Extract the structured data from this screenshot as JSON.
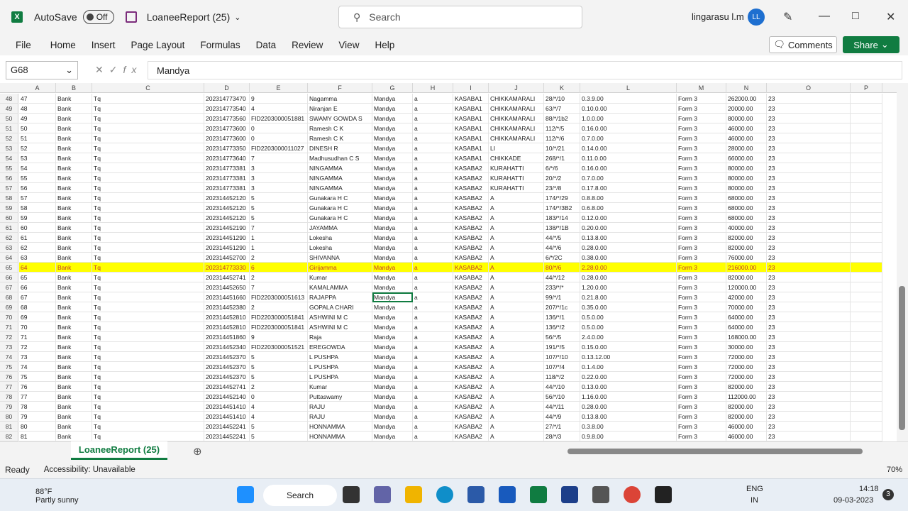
{
  "title": {
    "autosave_label": "AutoSave",
    "toggle_state": "Off",
    "doc_name": "LoaneeReport (25)",
    "search_placeholder": "Search",
    "user_name": "lingarasu l.m",
    "avatar_initials": "LL"
  },
  "menu": {
    "items": [
      "File",
      "Home",
      "Insert",
      "Page Layout",
      "Formulas",
      "Data",
      "Review",
      "View",
      "Help"
    ],
    "comments_label": "Comments",
    "share_label": "Share"
  },
  "formula": {
    "name_box": "G68",
    "fx": "fx",
    "value": "Mandya"
  },
  "columns": [
    "A",
    "B",
    "C",
    "D",
    "E",
    "F",
    "G",
    "H",
    "I",
    "J",
    "K",
    "L",
    "M",
    "N",
    "O",
    "P"
  ],
  "rows": [
    {
      "n": "48",
      "a": "47",
      "d": "202314773470",
      "e": "9",
      "f": "Nagamma",
      "i": "KASABA1",
      "j": "CHIKKAMARALI",
      "k": "28/*/10",
      "l": "0.3.9.00",
      "n2": "262000.00"
    },
    {
      "n": "49",
      "a": "48",
      "d": "202314773540",
      "e": "4",
      "f": "Niranjan E",
      "i": "KASABA1",
      "j": "CHIKKAMARALI",
      "k": "63/*/7",
      "l": "0.10.0.00",
      "n2": "20000.00"
    },
    {
      "n": "50",
      "a": "49",
      "d": "202314773560",
      "e": "FID2203000051881",
      "f": "SWAMY GOWDA S",
      "i": "KASABA1",
      "j": "CHIKKAMARALI",
      "k": "88/*/1b2",
      "l": "1.0.0.00",
      "n2": "80000.00"
    },
    {
      "n": "51",
      "a": "50",
      "d": "202314773600",
      "e": "0",
      "f": "Ramesh C K",
      "i": "KASABA1",
      "j": "CHIKKAMARALI",
      "k": "112/*/5",
      "l": "0.16.0.00",
      "n2": "46000.00"
    },
    {
      "n": "52",
      "a": "51",
      "d": "202314773600",
      "e": "0",
      "f": "Ramesh C K",
      "i": "KASABA1",
      "j": "CHIKKAMARALI",
      "k": "112/*/6",
      "l": "0.7.0.00",
      "n2": "46000.00"
    },
    {
      "n": "53",
      "a": "52",
      "d": "202314773350",
      "e": "FID2203000011027",
      "f": "DINESH R",
      "i": "KASABA1",
      "j": "LI",
      "k": "10/*/21",
      "l": "0.14.0.00",
      "n2": "28000.00"
    },
    {
      "n": "54",
      "a": "53",
      "d": "202314773640",
      "e": "7",
      "f": "Madhusudhan C S",
      "i": "KASABA1",
      "j": "CHIKKADE",
      "k": "268/*/1",
      "l": "0.11.0.00",
      "n2": "66000.00"
    },
    {
      "n": "55",
      "a": "54",
      "d": "202314773381",
      "e": "3",
      "f": "NINGAMMA",
      "i": "KASABA2",
      "j": "KURAHATTI",
      "k": "6/*/6",
      "l": "0.16.0.00",
      "n2": "80000.00"
    },
    {
      "n": "56",
      "a": "55",
      "d": "202314773381",
      "e": "3",
      "f": "NINGAMMA",
      "i": "KASABA2",
      "j": "KURAHATTI",
      "k": "20/*/2",
      "l": "0.7.0.00",
      "n2": "80000.00"
    },
    {
      "n": "57",
      "a": "56",
      "d": "202314773381",
      "e": "3",
      "f": "NINGAMMA",
      "i": "KASABA2",
      "j": "KURAHATTI",
      "k": "23/*/8",
      "l": "0.17.8.00",
      "n2": "80000.00"
    },
    {
      "n": "58",
      "a": "57",
      "d": "202314452120",
      "e": "5",
      "f": "Gunakara H C",
      "i": "KASABA2",
      "j": "A",
      "k": "174/*/29",
      "l": "0.8.8.00",
      "n2": "68000.00"
    },
    {
      "n": "59",
      "a": "58",
      "d": "202314452120",
      "e": "5",
      "f": "Gunakara H C",
      "i": "KASABA2",
      "j": "A",
      "k": "174/*/3B2",
      "l": "0.6.8.00",
      "n2": "68000.00"
    },
    {
      "n": "60",
      "a": "59",
      "d": "202314452120",
      "e": "5",
      "f": "Gunakara H C",
      "i": "KASABA2",
      "j": "A",
      "k": "183/*/14",
      "l": "0.12.0.00",
      "n2": "68000.00"
    },
    {
      "n": "61",
      "a": "60",
      "d": "202314452190",
      "e": "7",
      "f": "JAYAMMA",
      "i": "KASABA2",
      "j": "A",
      "k": "138/*/1B",
      "l": "0.20.0.00",
      "n2": "40000.00"
    },
    {
      "n": "62",
      "a": "61",
      "d": "202314451290",
      "e": "1",
      "f": "Lokesha",
      "i": "KASABA2",
      "j": "A",
      "k": "44/*/5",
      "l": "0.13.8.00",
      "n2": "82000.00"
    },
    {
      "n": "63",
      "a": "62",
      "d": "202314451290",
      "e": "1",
      "f": "Lokesha",
      "i": "KASABA2",
      "j": "A",
      "k": "44/*/6",
      "l": "0.28.0.00",
      "n2": "82000.00"
    },
    {
      "n": "64",
      "a": "63",
      "d": "202314452700",
      "e": "2",
      "f": "SHIVANNA",
      "i": "KASABA2",
      "j": "A",
      "k": "6/*/2C",
      "l": "0.38.0.00",
      "n2": "76000.00"
    },
    {
      "n": "65",
      "a": "64",
      "d": "202314773330",
      "e": "6",
      "f": "Girijamma",
      "i": "KASABA2",
      "j": "A",
      "k": "80/*/6",
      "l": "2.28.0.00",
      "n2": "216000.00",
      "hl": true
    },
    {
      "n": "66",
      "a": "65",
      "d": "202314452741",
      "e": "2",
      "f": "Kumar",
      "i": "KASABA2",
      "j": "A",
      "k": "44/*/12",
      "l": "0.28.0.00",
      "n2": "82000.00"
    },
    {
      "n": "67",
      "a": "66",
      "d": "202314452650",
      "e": "7",
      "f": "KAMALAMMA",
      "i": "KASABA2",
      "j": "A",
      "k": "233/*/*",
      "l": "1.20.0.00",
      "n2": "120000.00"
    },
    {
      "n": "68",
      "a": "67",
      "d": "202314451660",
      "e": "FID2203000051613",
      "f": "RAJAPPA",
      "i": "KASABA2",
      "j": "A",
      "k": "99/*/1",
      "l": "0.21.8.00",
      "n2": "42000.00",
      "sel": true
    },
    {
      "n": "69",
      "a": "68",
      "d": "202314452380",
      "e": "2",
      "f": "GOPALA CHARI",
      "i": "KASABA2",
      "j": "A",
      "k": "207/*/1c",
      "l": "0.35.0.00",
      "n2": "70000.00"
    },
    {
      "n": "70",
      "a": "69",
      "d": "202314452810",
      "e": "FID2203000051841",
      "f": "ASHWINI M C",
      "i": "KASABA2",
      "j": "A",
      "k": "136/*/1",
      "l": "0.5.0.00",
      "n2": "64000.00"
    },
    {
      "n": "71",
      "a": "70",
      "d": "202314452810",
      "e": "FID2203000051841",
      "f": "ASHWINI M C",
      "i": "KASABA2",
      "j": "A",
      "k": "136/*/2",
      "l": "0.5.0.00",
      "n2": "64000.00"
    },
    {
      "n": "72",
      "a": "71",
      "d": "202314451860",
      "e": "9",
      "f": "Raja",
      "i": "KASABA2",
      "j": "A",
      "k": "56/*/5",
      "l": "2.4.0.00",
      "n2": "168000.00"
    },
    {
      "n": "73",
      "a": "72",
      "d": "202314452340",
      "e": "FID2203000051521",
      "f": "EREGOWDA",
      "i": "KASABA2",
      "j": "A",
      "k": "191/*/5",
      "l": "0.15.0.00",
      "n2": "30000.00"
    },
    {
      "n": "74",
      "a": "73",
      "d": "202314452370",
      "e": "5",
      "f": "L PUSHPA",
      "i": "KASABA2",
      "j": "A",
      "k": "107/*/10",
      "l": "0.13.12.00",
      "n2": "72000.00"
    },
    {
      "n": "75",
      "a": "74",
      "d": "202314452370",
      "e": "5",
      "f": "L PUSHPA",
      "i": "KASABA2",
      "j": "A",
      "k": "107/*/4",
      "l": "0.1.4.00",
      "n2": "72000.00"
    },
    {
      "n": "76",
      "a": "75",
      "d": "202314452370",
      "e": "5",
      "f": "L PUSHPA",
      "i": "KASABA2",
      "j": "A",
      "k": "118/*/2",
      "l": "0.22.0.00",
      "n2": "72000.00"
    },
    {
      "n": "77",
      "a": "76",
      "d": "202314452741",
      "e": "2",
      "f": "Kumar",
      "i": "KASABA2",
      "j": "A",
      "k": "44/*/10",
      "l": "0.13.0.00",
      "n2": "82000.00"
    },
    {
      "n": "78",
      "a": "77",
      "d": "202314452140",
      "e": "0",
      "f": "Puttaswamy",
      "i": "KASABA2",
      "j": "A",
      "k": "56/*/10",
      "l": "1.16.0.00",
      "n2": "112000.00"
    },
    {
      "n": "79",
      "a": "78",
      "d": "202314451410",
      "e": "4",
      "f": "RAJU",
      "i": "KASABA2",
      "j": "A",
      "k": "44/*/11",
      "l": "0.28.0.00",
      "n2": "82000.00"
    },
    {
      "n": "80",
      "a": "79",
      "d": "202314451410",
      "e": "4",
      "f": "RAJU",
      "i": "KASABA2",
      "j": "A",
      "k": "44/*/9",
      "l": "0.13.8.00",
      "n2": "82000.00"
    },
    {
      "n": "81",
      "a": "80",
      "d": "202314452241",
      "e": "5",
      "f": "HONNAMMA",
      "i": "KASABA2",
      "j": "A",
      "k": "27/*/1",
      "l": "0.3.8.00",
      "n2": "46000.00"
    },
    {
      "n": "82",
      "a": "81",
      "d": "202314452241",
      "e": "5",
      "f": "HONNAMMA",
      "i": "KASABA2",
      "j": "A",
      "k": "28/*/3",
      "l": "0.9.8.00",
      "n2": "46000.00"
    }
  ],
  "common": {
    "b": "Bank",
    "c": "Tq",
    "g": "Mandya",
    "h": "a",
    "m": "Form 3",
    "o": "23"
  },
  "sheet": {
    "tab": "LoaneeReport (25)"
  },
  "status": {
    "ready": "Ready",
    "accessibility": "Accessibility: Unavailable",
    "zoom": "70%"
  },
  "taskbar": {
    "weather_temp": "88°F",
    "weather_desc": "Partly sunny",
    "search": "Search",
    "lang1": "ENG",
    "lang2": "IN",
    "time": "14:18",
    "date": "09-03-2023",
    "notif": "3"
  },
  "colors": {
    "excel_green": "#107c41",
    "highlight": "#ffff00"
  }
}
